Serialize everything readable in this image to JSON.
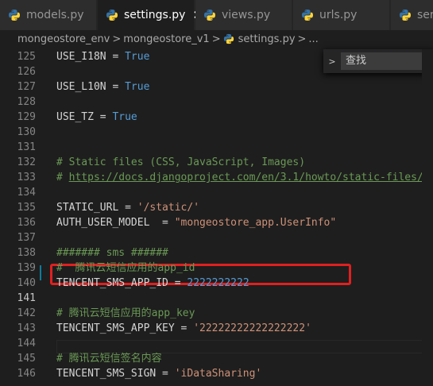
{
  "tabs": [
    {
      "label": "models.py",
      "active": false
    },
    {
      "label": "settings.py",
      "active": true,
      "close": "✕"
    },
    {
      "label": "views.py",
      "active": false
    },
    {
      "label": "urls.py",
      "active": false
    },
    {
      "label": "seria",
      "active": false
    }
  ],
  "breadcrumbs": {
    "items": [
      "mongeostore_env",
      "mongeostore_v1",
      "settings.py",
      "..."
    ],
    "separator": ">"
  },
  "find": {
    "toggle": ">",
    "placeholder": "查找"
  },
  "lines": [
    {
      "n": "125",
      "code": [
        [
          "t-id",
          "USE_I18N = "
        ],
        [
          "t-kw",
          "True"
        ]
      ]
    },
    {
      "n": "126",
      "code": []
    },
    {
      "n": "127",
      "code": [
        [
          "t-id",
          "USE_L10N = "
        ],
        [
          "t-kw",
          "True"
        ]
      ]
    },
    {
      "n": "128",
      "code": []
    },
    {
      "n": "129",
      "code": [
        [
          "t-id",
          "USE_TZ = "
        ],
        [
          "t-kw",
          "True"
        ]
      ]
    },
    {
      "n": "130",
      "code": []
    },
    {
      "n": "131",
      "code": []
    },
    {
      "n": "132",
      "code": [
        [
          "t-cmt",
          "# Static files (CSS, JavaScript, Images)"
        ]
      ]
    },
    {
      "n": "133",
      "code": [
        [
          "t-cmt",
          "# "
        ],
        [
          "t-link",
          "https://docs.djangoproject.com/en/3.1/howto/static-files/"
        ]
      ]
    },
    {
      "n": "134",
      "code": []
    },
    {
      "n": "135",
      "code": [
        [
          "t-id",
          "STATIC_URL = "
        ],
        [
          "t-str",
          "'/static/'"
        ]
      ]
    },
    {
      "n": "136",
      "code": [
        [
          "t-id",
          "AUTH_USER_MODEL  = "
        ],
        [
          "t-str",
          "\"mongeostore_app.UserInfo\""
        ]
      ]
    },
    {
      "n": "137",
      "code": []
    },
    {
      "n": "138",
      "code": [
        [
          "t-cmt",
          "####### sms ######"
        ]
      ]
    },
    {
      "n": "139",
      "code": [
        [
          "t-cmt",
          "#  腾讯云短信应用的app_id"
        ]
      ]
    },
    {
      "n": "140",
      "code": [
        [
          "t-id",
          "TENCENT_SMS_APP_ID = "
        ],
        [
          "t-kw",
          "2222222222"
        ]
      ]
    },
    {
      "n": "141",
      "code": []
    },
    {
      "n": "142",
      "code": [
        [
          "t-cmt",
          "# 腾讯云短信应用的app_key"
        ]
      ]
    },
    {
      "n": "143",
      "code": [
        [
          "t-id",
          "TENCENT_SMS_APP_KEY = "
        ],
        [
          "t-str",
          "'22222222222222222'"
        ]
      ]
    },
    {
      "n": "144",
      "code": []
    },
    {
      "n": "145",
      "code": [
        [
          "t-cmt",
          "# 腾讯云短信签名内容"
        ]
      ]
    },
    {
      "n": "146",
      "code": [
        [
          "t-id",
          "TENCENT_SMS_SIGN = "
        ],
        [
          "t-str",
          "'iDataSharing'"
        ]
      ]
    }
  ],
  "colors": {
    "python_blue": "#3572a5",
    "python_yellow": "#ffd43b",
    "highlight_box": "#e02020"
  }
}
